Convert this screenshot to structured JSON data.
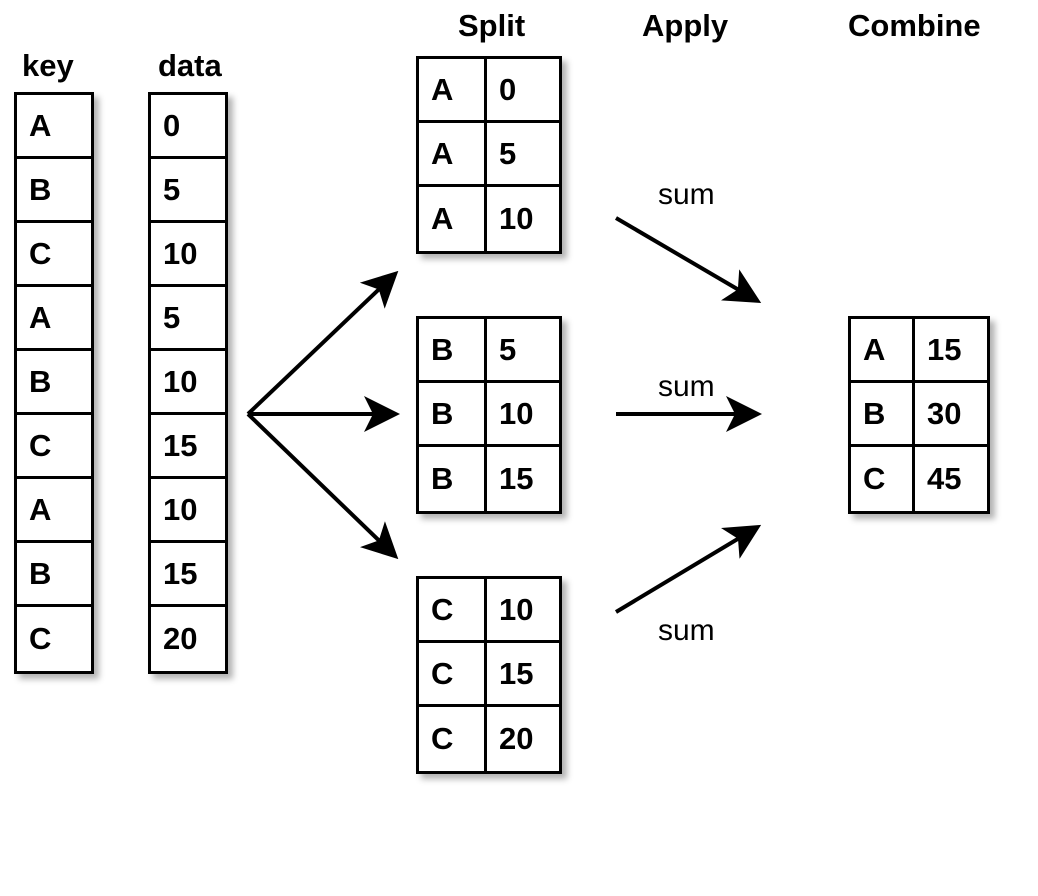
{
  "headings": {
    "key": "key",
    "data": "data",
    "split": "Split",
    "apply": "Apply",
    "combine": "Combine"
  },
  "input": {
    "key": [
      "A",
      "B",
      "C",
      "A",
      "B",
      "C",
      "A",
      "B",
      "C"
    ],
    "data": [
      "0",
      "5",
      "10",
      "5",
      "10",
      "15",
      "10",
      "15",
      "20"
    ]
  },
  "split_groups": [
    {
      "rows": [
        [
          "A",
          "0"
        ],
        [
          "A",
          "5"
        ],
        [
          "A",
          "10"
        ]
      ]
    },
    {
      "rows": [
        [
          "B",
          "5"
        ],
        [
          "B",
          "10"
        ],
        [
          "B",
          "15"
        ]
      ]
    },
    {
      "rows": [
        [
          "C",
          "10"
        ],
        [
          "C",
          "15"
        ],
        [
          "C",
          "20"
        ]
      ]
    }
  ],
  "apply_label": "sum",
  "combine": {
    "rows": [
      [
        "A",
        "15"
      ],
      [
        "B",
        "30"
      ],
      [
        "C",
        "45"
      ]
    ]
  },
  "chart_data": {
    "type": "table",
    "operation": "split-apply-combine (groupby sum)",
    "input": {
      "key": [
        "A",
        "B",
        "C",
        "A",
        "B",
        "C",
        "A",
        "B",
        "C"
      ],
      "data": [
        0,
        5,
        10,
        5,
        10,
        15,
        10,
        15,
        20
      ]
    },
    "groups": {
      "A": [
        0,
        5,
        10
      ],
      "B": [
        5,
        10,
        15
      ],
      "C": [
        10,
        15,
        20
      ]
    },
    "aggregate": "sum",
    "result": {
      "A": 15,
      "B": 30,
      "C": 45
    }
  }
}
